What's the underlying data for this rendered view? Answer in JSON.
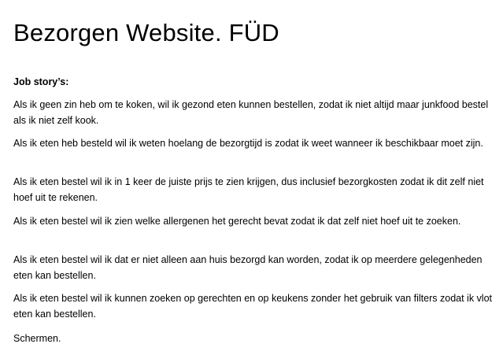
{
  "document": {
    "title": "Bezorgen Website. FÜD",
    "section_heading": "Job story’s:",
    "stories": [
      "Als ik geen zin heb om te koken, wil ik gezond eten kunnen bestellen, zodat ik niet altijd maar junkfood bestel als ik niet zelf kook.",
      "Als ik eten heb besteld wil ik weten hoelang de bezorgtijd is zodat ik weet wanneer ik beschikbaar moet zijn.",
      "Als ik eten bestel wil ik in 1 keer de juiste prijs te zien krijgen, dus inclusief bezorgkosten zodat ik dit zelf niet hoef uit te rekenen.",
      "Als ik eten bestel wil ik zien welke allergenen het gerecht bevat zodat ik dat zelf niet hoef uit te zoeken.",
      "Als ik eten bestel wil ik dat er niet alleen aan huis bezorgd kan worden, zodat ik op meerdere gelegenheden eten kan bestellen.",
      "Als ik eten bestel wil ik kunnen zoeken op gerechten en op keukens zonder het gebruik van filters zodat ik vlot eten kan bestellen."
    ],
    "closing": "Schermen."
  }
}
